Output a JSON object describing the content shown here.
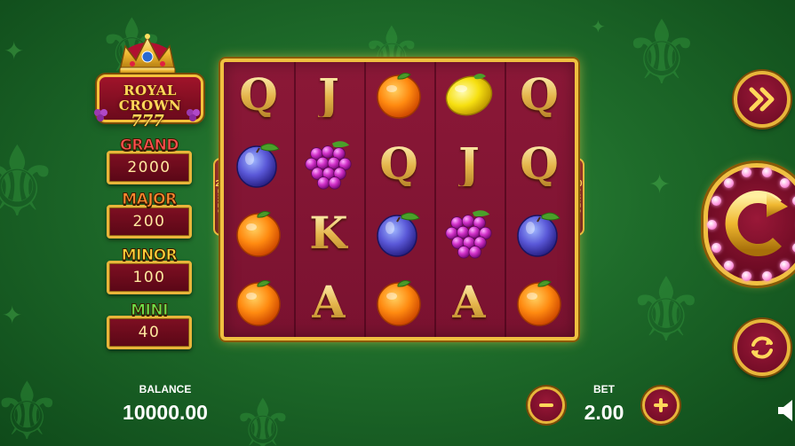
{
  "game": {
    "logo": {
      "line1": "ROYAL",
      "line2": "CROWN",
      "line3": "777"
    },
    "jackpots": [
      {
        "name": "GRAND",
        "value": "2000",
        "color": "#ff5050"
      },
      {
        "name": "MAJOR",
        "value": "200",
        "color": "#ff8a30"
      },
      {
        "name": "MINOR",
        "value": "100",
        "color": "#ffd23a"
      },
      {
        "name": "MINI",
        "value": "40",
        "color": "#6ee04a"
      }
    ],
    "lines": {
      "count": "20",
      "word": "LINES"
    },
    "reels": [
      [
        "Q",
        "plum",
        "orange",
        "orange"
      ],
      [
        "J",
        "grapes",
        "K",
        "A"
      ],
      [
        "orange",
        "Q",
        "plum",
        "orange"
      ],
      [
        "lemon",
        "J",
        "grapes",
        "A"
      ],
      [
        "Q",
        "Q",
        "plum",
        "orange"
      ]
    ],
    "balance": {
      "label": "BALANCE",
      "value": "10000.00"
    },
    "bet": {
      "label": "BET",
      "value": "2.00"
    },
    "buttons": {
      "turbo_icon": "fast-forward-icon",
      "spin_icon": "spin-icon",
      "autoplay_icon": "autoplay-icon",
      "minus_icon": "minus-icon",
      "plus_icon": "plus-icon",
      "sound_icon": "sound-icon"
    }
  }
}
